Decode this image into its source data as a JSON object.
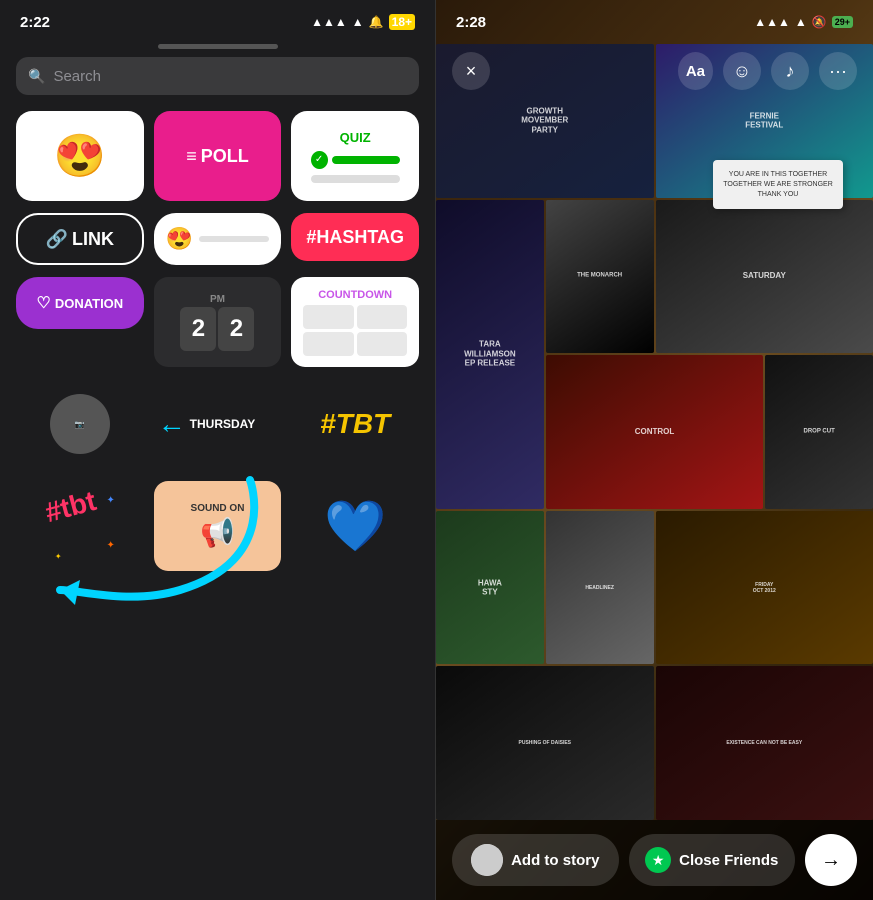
{
  "left_phone": {
    "status_time": "2:22",
    "battery": "18+",
    "search_placeholder": "Search",
    "stickers": {
      "row1": [
        {
          "id": "emoji-face",
          "type": "emoji",
          "emoji": "😍",
          "label": "Emoji"
        },
        {
          "id": "poll",
          "type": "poll",
          "label": "POLL",
          "icon": "≡"
        },
        {
          "id": "quiz",
          "type": "quiz",
          "label": "QUIZ"
        }
      ],
      "row2": [
        {
          "id": "link",
          "type": "link",
          "label": "LINK",
          "icon": "🔗"
        },
        {
          "id": "emoji-slider",
          "type": "slider",
          "emoji": "😍"
        },
        {
          "id": "hashtag",
          "type": "hashtag",
          "label": "#HASHTAG"
        }
      ],
      "row3": [
        {
          "id": "donation",
          "type": "donation",
          "label": "DONATION",
          "icon": "♡"
        },
        {
          "id": "timer",
          "type": "timer",
          "digits": [
            "2",
            "2"
          ]
        },
        {
          "id": "countdown",
          "type": "countdown",
          "label": "COUNTDOWN"
        }
      ],
      "row4": [
        {
          "id": "avatar",
          "type": "avatar"
        },
        {
          "id": "throwback",
          "type": "text",
          "label": "THURSDAY"
        },
        {
          "id": "tbt",
          "type": "tbt",
          "label": "#TBT"
        }
      ],
      "row5": [
        {
          "id": "hashtag2",
          "type": "sticker-img",
          "label": "#tbt"
        },
        {
          "id": "soundon",
          "type": "sticker-img",
          "label": "SOUND ON"
        },
        {
          "id": "heart",
          "type": "heart",
          "emoji": "💙"
        }
      ]
    }
  },
  "right_phone": {
    "status_time": "2:28",
    "battery": "29+",
    "toolbar": {
      "close_label": "×",
      "text_label": "Aa",
      "sticker_label": "☺",
      "music_label": "♪",
      "more_label": "···"
    },
    "sticky_note": {
      "line1": "YOU ARE IN THIS TOGETHER",
      "line2": "TOGETHER WE ARE STRONGER",
      "line3": "THANK YOU"
    },
    "bottom_bar": {
      "add_to_story": "Add to story",
      "close_friends": "Close Friends",
      "share_arrow": "→"
    },
    "posters": [
      {
        "label": "GROWTH MOVEMBER PARTY"
      },
      {
        "label": "FERNIE FESTIVAL"
      },
      {
        "label": "TARA WILLIAMSON"
      },
      {
        "label": "CONTROL"
      },
      {
        "label": "SATURDAY"
      },
      {
        "label": "HAWA STY"
      },
      {
        "label": "DROP CUT"
      },
      {
        "label": "PUSHING OF DAISIES"
      },
      {
        "label": ""
      }
    ]
  }
}
